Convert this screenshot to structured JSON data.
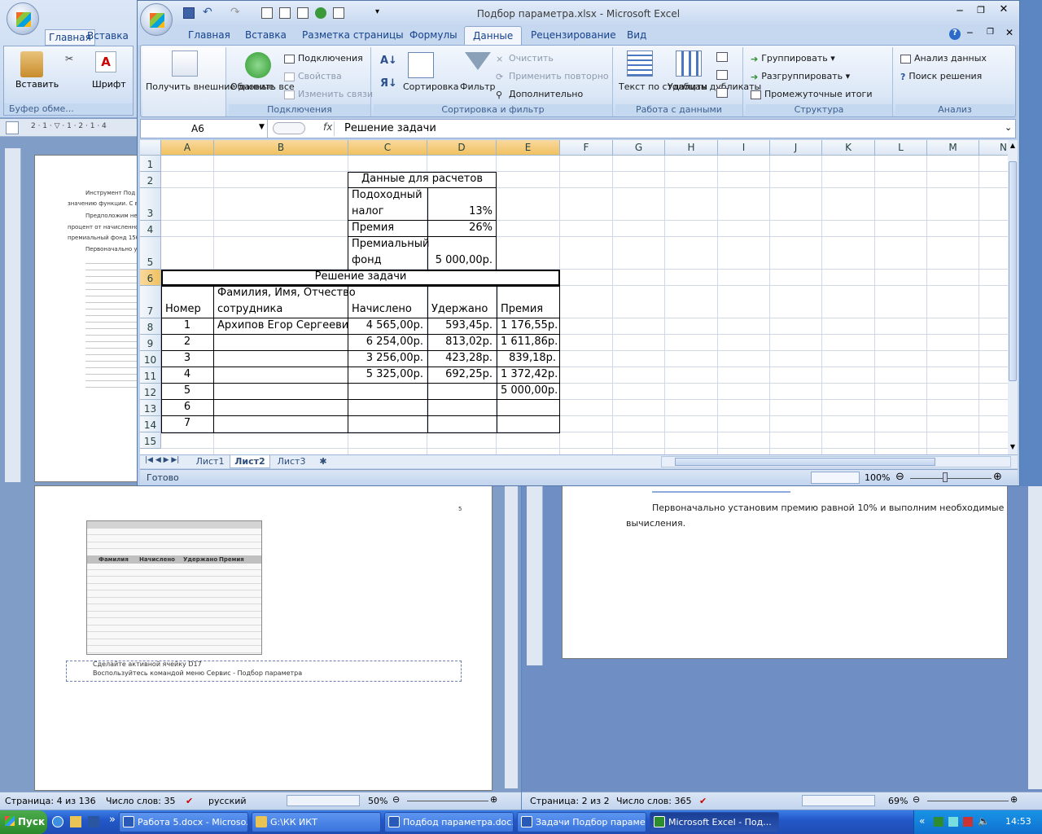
{
  "excel": {
    "title": "Подбор параметра.xlsx - Microsoft Excel",
    "tabs": [
      "Главная",
      "Вставка",
      "Разметка страницы",
      "Формулы",
      "Данные",
      "Рецензирование",
      "Вид"
    ],
    "ribbon": {
      "get_external": "Получить внешние данные",
      "refresh_all": "Обновить все",
      "connections": "Подключения",
      "properties": "Свойства",
      "edit_links": "Изменить связи",
      "group_connections": "Подключения",
      "sort": "Сортировка",
      "filter": "Фильтр",
      "clear": "Очистить",
      "reapply": "Применить повторно",
      "advanced": "Дополнительно",
      "group_sort": "Сортировка и фильтр",
      "text_to_cols": "Текст по столбцам",
      "remove_dups": "Удалить дубликаты",
      "group_data": "Работа с данными",
      "group_btn": "Группировать",
      "ungroup_btn": "Разгруппировать",
      "subtotals": "Промежуточные итоги",
      "group_outline": "Структура",
      "data_analysis": "Анализ данных",
      "solver": "Поиск решения",
      "group_analysis": "Анализ"
    },
    "name_box": "A6",
    "formula": "Решение задачи",
    "fx": "fx",
    "columns": [
      "A",
      "B",
      "C",
      "D",
      "E",
      "F",
      "G",
      "H",
      "I",
      "J",
      "K",
      "L",
      "M",
      "N"
    ],
    "rows": [
      "1",
      "2",
      "3",
      "4",
      "5",
      "6",
      "7",
      "8",
      "9",
      "10",
      "11",
      "12",
      "13",
      "14",
      "15"
    ],
    "cells": {
      "c2": "Данные для расчетов",
      "c3a": "Подоходный",
      "c3b": "налог",
      "d3": "13%",
      "c4": "Премия",
      "d4": "26%",
      "c5a": "Премиальный",
      "c5b": "фонд",
      "d5": "5 000,00р.",
      "a6": "Решение задачи",
      "a7": "Номер",
      "b7a": "Фамилия, Имя, Отчество",
      "b7b": "сотрудника",
      "c7": "Начислено",
      "d7": "Удержано",
      "e7": "Премия",
      "b8": "Архипов Егор Сергеевич"
    },
    "table_rows": [
      {
        "num": "1",
        "c": "4 565,00р.",
        "d": "593,45р.",
        "e": "1 176,55р."
      },
      {
        "num": "2",
        "c": "6 254,00р.",
        "d": "813,02р.",
        "e": "1 611,86р."
      },
      {
        "num": "3",
        "c": "3 256,00р.",
        "d": "423,28р.",
        "e": "839,18р."
      },
      {
        "num": "4",
        "c": "5 325,00р.",
        "d": "692,25р.",
        "e": "1 372,42р."
      },
      {
        "num": "5",
        "c": "",
        "d": "",
        "e": "5 000,00р."
      },
      {
        "num": "6",
        "c": "",
        "d": "",
        "e": ""
      },
      {
        "num": "7",
        "c": "",
        "d": "",
        "e": ""
      }
    ],
    "sheets": [
      "Лист1",
      "Лист2",
      "Лист3"
    ],
    "status": "Готово",
    "zoom": "100%"
  },
  "word_left": {
    "status": {
      "page": "Страница: 4 из 136",
      "words": "Число слов: 35",
      "lang": "русский",
      "zoom": "50%"
    },
    "lines": [
      "Сделайте активной ячейку D17",
      "Воспользуйтесь командой меню Сервис - Подбор параметра"
    ],
    "frags": [
      "Инструмент Под",
      "значению функции. С в",
      "Предположим не",
      "процент от начисленно",
      "премиальный фонд 150",
      "Первоначально у"
    ],
    "mini_table": {
      "headers": [
        "Фамилия",
        "Начислено",
        "Удержано",
        "Премия"
      ],
      "top": [
        [
          "1",
          "0,13",
          "подоходный налог"
        ],
        [
          "2",
          "0,1",
          "премия"
        ],
        [
          "3",
          "15000",
          "премиальный фонд"
        ]
      ],
      "names": [
        "Алехин",
        "Баранов",
        "Баранова",
        "Димова",
        "Иванов",
        "Иванова",
        "Ковалева",
        "Ковалев",
        "Ломтин",
        "Петров",
        "Сидоров",
        "Итого"
      ],
      "vals": [
        "10000",
        "892",
        "2987",
        "2345",
        "345",
        "16767",
        "4567",
        "2256",
        "5226",
        "6533",
        "6633",
        "=СУММ(B6:B16)"
      ]
    }
  },
  "word_right": {
    "text1": "Первоначально установим премию равной 10% и выполним необходимые",
    "text2": "вычисления.",
    "status": {
      "page": "Страница: 2 из 2",
      "words": "Число слов: 365",
      "zoom": "69%"
    }
  },
  "taskbar": {
    "start": "Пуск",
    "items": [
      "Работа 5.docx - Microso...",
      "G:\\КК ИКТ",
      "Подбод параметра.doc...",
      "Задачи Подбор параме...",
      "Microsoft Excel - Под..."
    ],
    "lang": "RU",
    "time": "14:53"
  }
}
